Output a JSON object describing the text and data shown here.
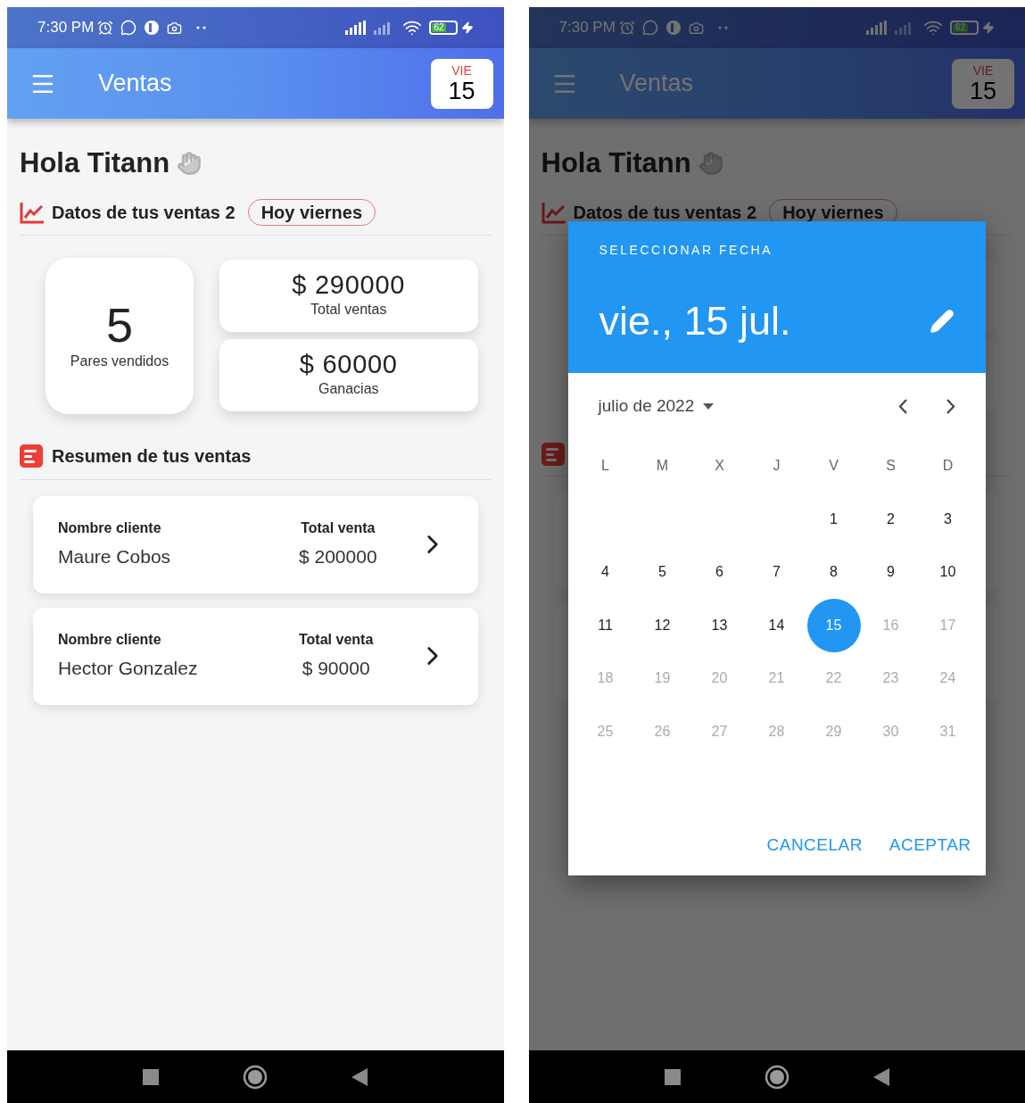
{
  "screens": [
    {
      "status_bar": {
        "time": "7:30 PM",
        "battery": "62"
      },
      "app_bar": {
        "title": "Ventas",
        "day_name": "VIE",
        "day_number": "15"
      },
      "greeting": "Hola Titann",
      "sales_section": {
        "title": "Datos de tus ventas 2",
        "chip": "Hoy viernes"
      },
      "stats": {
        "pairs": {
          "value": "5",
          "label": "Pares vendidos"
        },
        "totals": [
          {
            "value": "$ 290000",
            "label": "Total ventas"
          },
          {
            "value": "$ 60000",
            "label": "Ganacias"
          }
        ]
      },
      "summary": {
        "title": "Resumen de tus ventas",
        "sales": [
          {
            "client_label": "Nombre cliente",
            "client": "Maure Cobos",
            "total_label": "Total venta",
            "total": "$ 200000"
          },
          {
            "client_label": "Nombre cliente",
            "client": "Hector Gonzalez",
            "total_label": "Total venta",
            "total": "$ 90000"
          }
        ]
      }
    },
    {
      "status_bar": {
        "time": "7:30 PM",
        "battery": "62"
      },
      "app_bar": {
        "title": "Ventas",
        "day_name": "VIE",
        "day_number": "15"
      },
      "greeting": "Hola Titann",
      "sales_section": {
        "title": "Datos de tus ventas 2",
        "chip": "Hoy viernes"
      },
      "date_picker": {
        "heading": "SELECCIONAR FECHA",
        "selected_date": "vie., 15 jul.",
        "month": "julio de 2022",
        "weekdays": [
          "L",
          "M",
          "X",
          "J",
          "V",
          "S",
          "D"
        ],
        "days": [
          {
            "kind": "blank"
          },
          {
            "kind": "blank"
          },
          {
            "kind": "blank"
          },
          {
            "kind": "blank"
          },
          {
            "kind": "day",
            "label": "1",
            "selected": false,
            "disabled": false
          },
          {
            "kind": "day",
            "label": "2",
            "selected": false,
            "disabled": false
          },
          {
            "kind": "day",
            "label": "3",
            "selected": false,
            "disabled": false
          },
          {
            "kind": "day",
            "label": "4",
            "selected": false,
            "disabled": false
          },
          {
            "kind": "day",
            "label": "5",
            "selected": false,
            "disabled": false
          },
          {
            "kind": "day",
            "label": "6",
            "selected": false,
            "disabled": false
          },
          {
            "kind": "day",
            "label": "7",
            "selected": false,
            "disabled": false
          },
          {
            "kind": "day",
            "label": "8",
            "selected": false,
            "disabled": false
          },
          {
            "kind": "day",
            "label": "9",
            "selected": false,
            "disabled": false
          },
          {
            "kind": "day",
            "label": "10",
            "selected": false,
            "disabled": false
          },
          {
            "kind": "day",
            "label": "11",
            "selected": false,
            "disabled": false
          },
          {
            "kind": "day",
            "label": "12",
            "selected": false,
            "disabled": false
          },
          {
            "kind": "day",
            "label": "13",
            "selected": false,
            "disabled": false
          },
          {
            "kind": "day",
            "label": "14",
            "selected": false,
            "disabled": false
          },
          {
            "kind": "day",
            "label": "15",
            "selected": true,
            "disabled": false
          },
          {
            "kind": "day",
            "label": "16",
            "selected": false,
            "disabled": true
          },
          {
            "kind": "day",
            "label": "17",
            "selected": false,
            "disabled": true
          },
          {
            "kind": "day",
            "label": "18",
            "selected": false,
            "disabled": true
          },
          {
            "kind": "day",
            "label": "19",
            "selected": false,
            "disabled": true
          },
          {
            "kind": "day",
            "label": "20",
            "selected": false,
            "disabled": true
          },
          {
            "kind": "day",
            "label": "21",
            "selected": false,
            "disabled": true
          },
          {
            "kind": "day",
            "label": "22",
            "selected": false,
            "disabled": true
          },
          {
            "kind": "day",
            "label": "23",
            "selected": false,
            "disabled": true
          },
          {
            "kind": "day",
            "label": "24",
            "selected": false,
            "disabled": true
          },
          {
            "kind": "day",
            "label": "25",
            "selected": false,
            "disabled": true
          },
          {
            "kind": "day",
            "label": "26",
            "selected": false,
            "disabled": true
          },
          {
            "kind": "day",
            "label": "27",
            "selected": false,
            "disabled": true
          },
          {
            "kind": "day",
            "label": "28",
            "selected": false,
            "disabled": true
          },
          {
            "kind": "day",
            "label": "29",
            "selected": false,
            "disabled": true
          },
          {
            "kind": "day",
            "label": "30",
            "selected": false,
            "disabled": true
          },
          {
            "kind": "day",
            "label": "31",
            "selected": false,
            "disabled": true
          }
        ],
        "actions": [
          "CANCELAR",
          "ACEPTAR"
        ]
      }
    }
  ]
}
